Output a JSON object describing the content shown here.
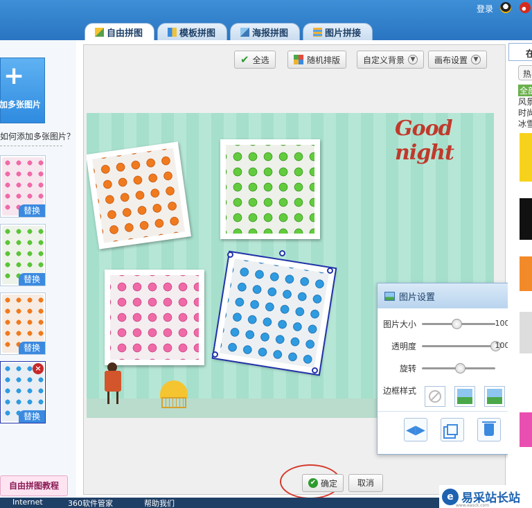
{
  "header": {
    "login": "登录",
    "tabs": [
      {
        "label": "自由拼图",
        "active": true
      },
      {
        "label": "模板拼图",
        "active": false
      },
      {
        "label": "海报拼图",
        "active": false
      },
      {
        "label": "图片拼接",
        "active": false
      }
    ],
    "right_tab": "在"
  },
  "left_panel": {
    "add_button": "加多张图片",
    "help_link": "如何添加多张图片？",
    "replace_label": "替换",
    "thumbnails": [
      {
        "color": "pink"
      },
      {
        "color": "green"
      },
      {
        "color": "orange"
      },
      {
        "color": "blue",
        "selected": true
      }
    ],
    "tutorial_button": "自由拼图教程"
  },
  "toolbar": {
    "select_all": "全选",
    "random_layout": "随机排版",
    "custom_background": "自定义背景",
    "canvas_settings": "画布设置"
  },
  "canvas": {
    "title_text": "Good night",
    "background_color": "#a6dfcc"
  },
  "image_settings": {
    "title": "图片设置",
    "size_label": "图片大小",
    "size_value": "100%",
    "size_fraction": 0.47,
    "opacity_label": "透明度",
    "opacity_value": "100%",
    "opacity_fraction": 1.0,
    "rotate_label": "旋转",
    "rotate_value": "9°",
    "rotate_fraction": 0.52,
    "border_label": "边框样式"
  },
  "footer": {
    "confirm": "确定",
    "cancel": "取消"
  },
  "right_strip": {
    "hot": "热",
    "categories": [
      "全部",
      "风景",
      "时尚",
      "冰雪"
    ]
  },
  "taskbar": {
    "items": [
      "Internet",
      "360软件管家",
      "帮助我们"
    ]
  },
  "watermark": {
    "brand": "易采站长站",
    "url": "www.easck.com"
  },
  "colors": {
    "accent": "#3b8ae0",
    "selection": "#2233aa",
    "highlight_circle": "#d43b2d"
  }
}
